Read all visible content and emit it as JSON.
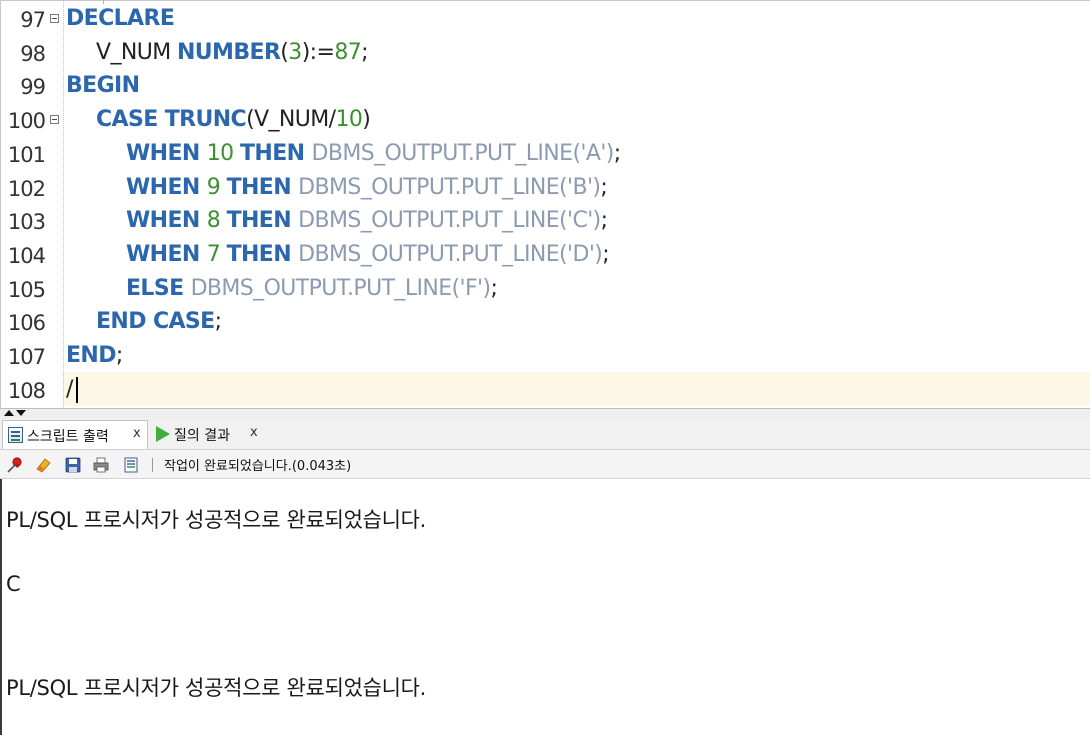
{
  "editor": {
    "lines": [
      {
        "num": "97",
        "fold": true,
        "indent": 0,
        "tokens": [
          {
            "t": "DECLARE",
            "c": "kw"
          }
        ]
      },
      {
        "num": "98",
        "fold": false,
        "indent": 1,
        "tokens": [
          {
            "t": "V_NUM ",
            "c": "id"
          },
          {
            "t": "NUMBER",
            "c": "kw"
          },
          {
            "t": "(",
            "c": "punc"
          },
          {
            "t": "3",
            "c": "num"
          },
          {
            "t": "):=",
            "c": "punc"
          },
          {
            "t": "87",
            "c": "num"
          },
          {
            "t": ";",
            "c": "punc"
          }
        ]
      },
      {
        "num": "99",
        "fold": false,
        "indent": 0,
        "tokens": [
          {
            "t": "BEGIN",
            "c": "kw"
          }
        ]
      },
      {
        "num": "100",
        "fold": true,
        "indent": 1,
        "tokens": [
          {
            "t": "CASE ",
            "c": "kw"
          },
          {
            "t": "TRUNC",
            "c": "kw"
          },
          {
            "t": "(V_NUM/",
            "c": "id"
          },
          {
            "t": "10",
            "c": "num"
          },
          {
            "t": ")",
            "c": "punc"
          }
        ]
      },
      {
        "num": "101",
        "fold": false,
        "indent": 2,
        "tokens": [
          {
            "t": "WHEN ",
            "c": "kw"
          },
          {
            "t": "10 ",
            "c": "num"
          },
          {
            "t": "THEN ",
            "c": "kw"
          },
          {
            "t": "DBMS_OUTPUT.PUT_LINE('A')",
            "c": "fn"
          },
          {
            "t": ";",
            "c": "punc"
          }
        ]
      },
      {
        "num": "102",
        "fold": false,
        "indent": 2,
        "tokens": [
          {
            "t": "WHEN ",
            "c": "kw"
          },
          {
            "t": "9 ",
            "c": "num"
          },
          {
            "t": "THEN ",
            "c": "kw"
          },
          {
            "t": "DBMS_OUTPUT.PUT_LINE('B')",
            "c": "fn"
          },
          {
            "t": ";",
            "c": "punc"
          }
        ]
      },
      {
        "num": "103",
        "fold": false,
        "indent": 2,
        "tokens": [
          {
            "t": "WHEN ",
            "c": "kw"
          },
          {
            "t": "8 ",
            "c": "num"
          },
          {
            "t": "THEN ",
            "c": "kw"
          },
          {
            "t": "DBMS_OUTPUT.PUT_LINE('C')",
            "c": "fn"
          },
          {
            "t": ";",
            "c": "punc"
          }
        ]
      },
      {
        "num": "104",
        "fold": false,
        "indent": 2,
        "tokens": [
          {
            "t": "WHEN ",
            "c": "kw"
          },
          {
            "t": "7 ",
            "c": "num"
          },
          {
            "t": "THEN ",
            "c": "kw"
          },
          {
            "t": "DBMS_OUTPUT.PUT_LINE('D')",
            "c": "fn"
          },
          {
            "t": ";",
            "c": "punc"
          }
        ]
      },
      {
        "num": "105",
        "fold": false,
        "indent": 2,
        "tokens": [
          {
            "t": "ELSE ",
            "c": "kw"
          },
          {
            "t": "DBMS_OUTPUT.PUT_LINE('F')",
            "c": "fn"
          },
          {
            "t": ";",
            "c": "punc"
          }
        ]
      },
      {
        "num": "106",
        "fold": false,
        "indent": 1,
        "tokens": [
          {
            "t": "END CASE",
            "c": "kw"
          },
          {
            "t": ";",
            "c": "punc"
          }
        ]
      },
      {
        "num": "107",
        "fold": false,
        "indent": 0,
        "tokens": [
          {
            "t": "END",
            "c": "kw"
          },
          {
            "t": ";",
            "c": "punc"
          }
        ]
      },
      {
        "num": "108",
        "fold": false,
        "indent": 0,
        "tokens": [
          {
            "t": "/",
            "c": "punc"
          }
        ]
      }
    ]
  },
  "panel": {
    "tabs": {
      "script_output": {
        "label": "스크립트 출력",
        "close": "x",
        "icon": "script-output-icon"
      },
      "query_result": {
        "label": "질의 결과",
        "close": "x",
        "icon": "play-icon"
      }
    },
    "toolbar": {
      "icons": [
        "pin-icon",
        "eraser-icon",
        "save-icon",
        "print-icon",
        "script-file-icon"
      ],
      "status": "작업이 완료되었습니다.(0.043초)"
    },
    "output": {
      "line1": "PL/SQL 프로시저가 성공적으로 완료되었습니다.",
      "line2": "C",
      "line3": "PL/SQL 프로시저가 성공적으로 완료되었습니다."
    }
  },
  "colors": {
    "keyword": "#2c67ad",
    "number": "#3e8f32",
    "function": "#8c9bb1",
    "current_line": "#fdf7e6"
  }
}
